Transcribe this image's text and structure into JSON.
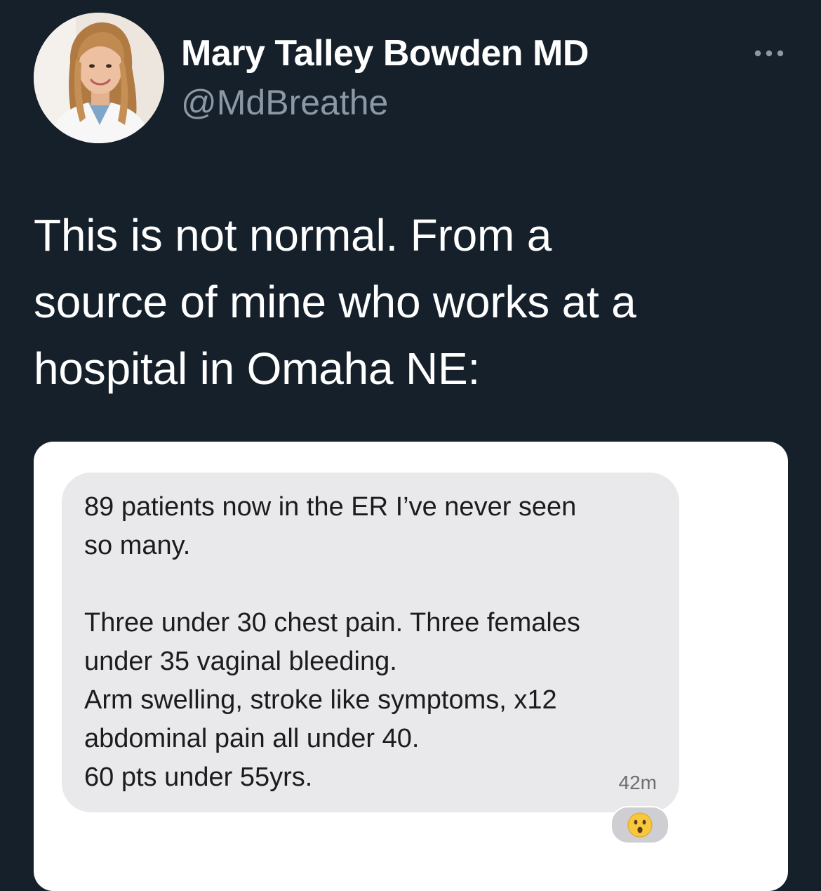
{
  "author": {
    "display_name": "Mary Talley Bowden MD",
    "handle": "@MdBreathe",
    "avatar_icon": "profile-photo"
  },
  "more_icon": "more-horizontal-icon",
  "tweet": {
    "text": "This is not normal.  From a\nsource of mine who works at a\nhospital in Omaha NE:"
  },
  "message": {
    "text": "89 patients now in the ER I’ve never seen\nso many.\n\nThree under 30 chest pain.  Three females\nunder 35 vaginal bleeding.\nArm swelling, stroke like symptoms, x12\nabdominal pain all under 40.\n60 pts under 55yrs.",
    "time": "42m",
    "reaction_icon": "surprised-face-emoji"
  },
  "colors": {
    "background": "#15202b",
    "text": "#ffffff",
    "secondary_text": "#8b98a5",
    "bubble": "#e9e9eb"
  }
}
